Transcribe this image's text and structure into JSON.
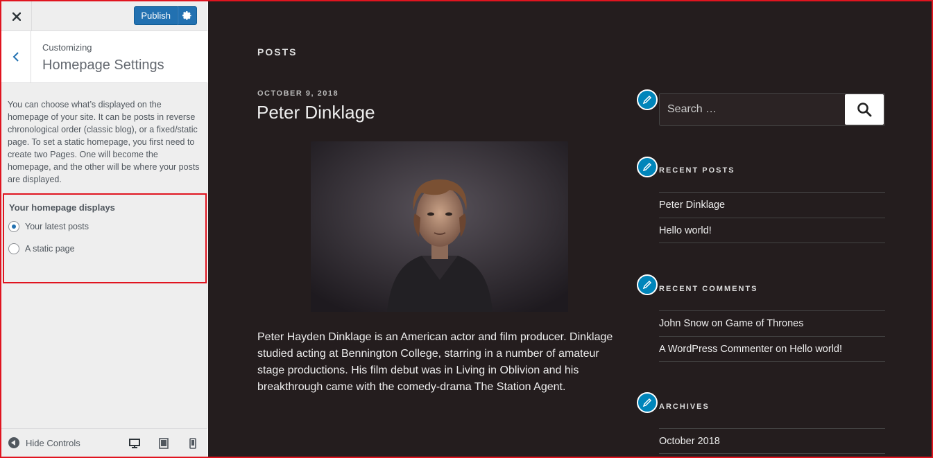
{
  "customizer": {
    "close_icon": "close-icon",
    "publish_label": "Publish",
    "settings_icon": "gear-icon",
    "customizing_label": "Customizing",
    "section_title": "Homepage Settings",
    "description": "You can choose what’s displayed on the homepage of your site. It can be posts in reverse chronological order (classic blog), or a fixed/static page. To set a static homepage, you first need to create two Pages. One will become the homepage, and the other will be where your posts are displayed.",
    "homepage_displays": {
      "title": "Your homepage displays",
      "options": [
        {
          "label": "Your latest posts",
          "checked": true
        },
        {
          "label": "A static page",
          "checked": false
        }
      ]
    },
    "footer": {
      "hide_controls_label": "Hide Controls",
      "devices": [
        "desktop-icon",
        "tablet-icon",
        "mobile-icon"
      ]
    },
    "accent_color": "#2271b1"
  },
  "preview": {
    "heading": "POSTS",
    "post": {
      "date": "OCTOBER 9, 2018",
      "title": "Peter Dinklage",
      "excerpt": "Peter Hayden Dinklage is an American actor and film producer. Dinklage studied acting at Bennington College, starring in a number of amateur stage productions. His film debut was in Living in Oblivion and his breakthrough came with the comedy-drama The Station Agent."
    },
    "search": {
      "placeholder": "Search …"
    },
    "recent_posts": {
      "title": "RECENT POSTS",
      "items": [
        "Peter Dinklage",
        "Hello world!"
      ]
    },
    "recent_comments": {
      "title": "RECENT COMMENTS",
      "items": [
        {
          "author": "John Snow",
          "on": "on",
          "post": "Game of Thrones"
        },
        {
          "author": "A WordPress Commenter",
          "on": "on",
          "post": "Hello world!"
        }
      ]
    },
    "archives": {
      "title": "ARCHIVES",
      "items": [
        "October 2018"
      ]
    },
    "background_color": "#241d1e",
    "edit_shortcut_color": "#0085ba"
  }
}
